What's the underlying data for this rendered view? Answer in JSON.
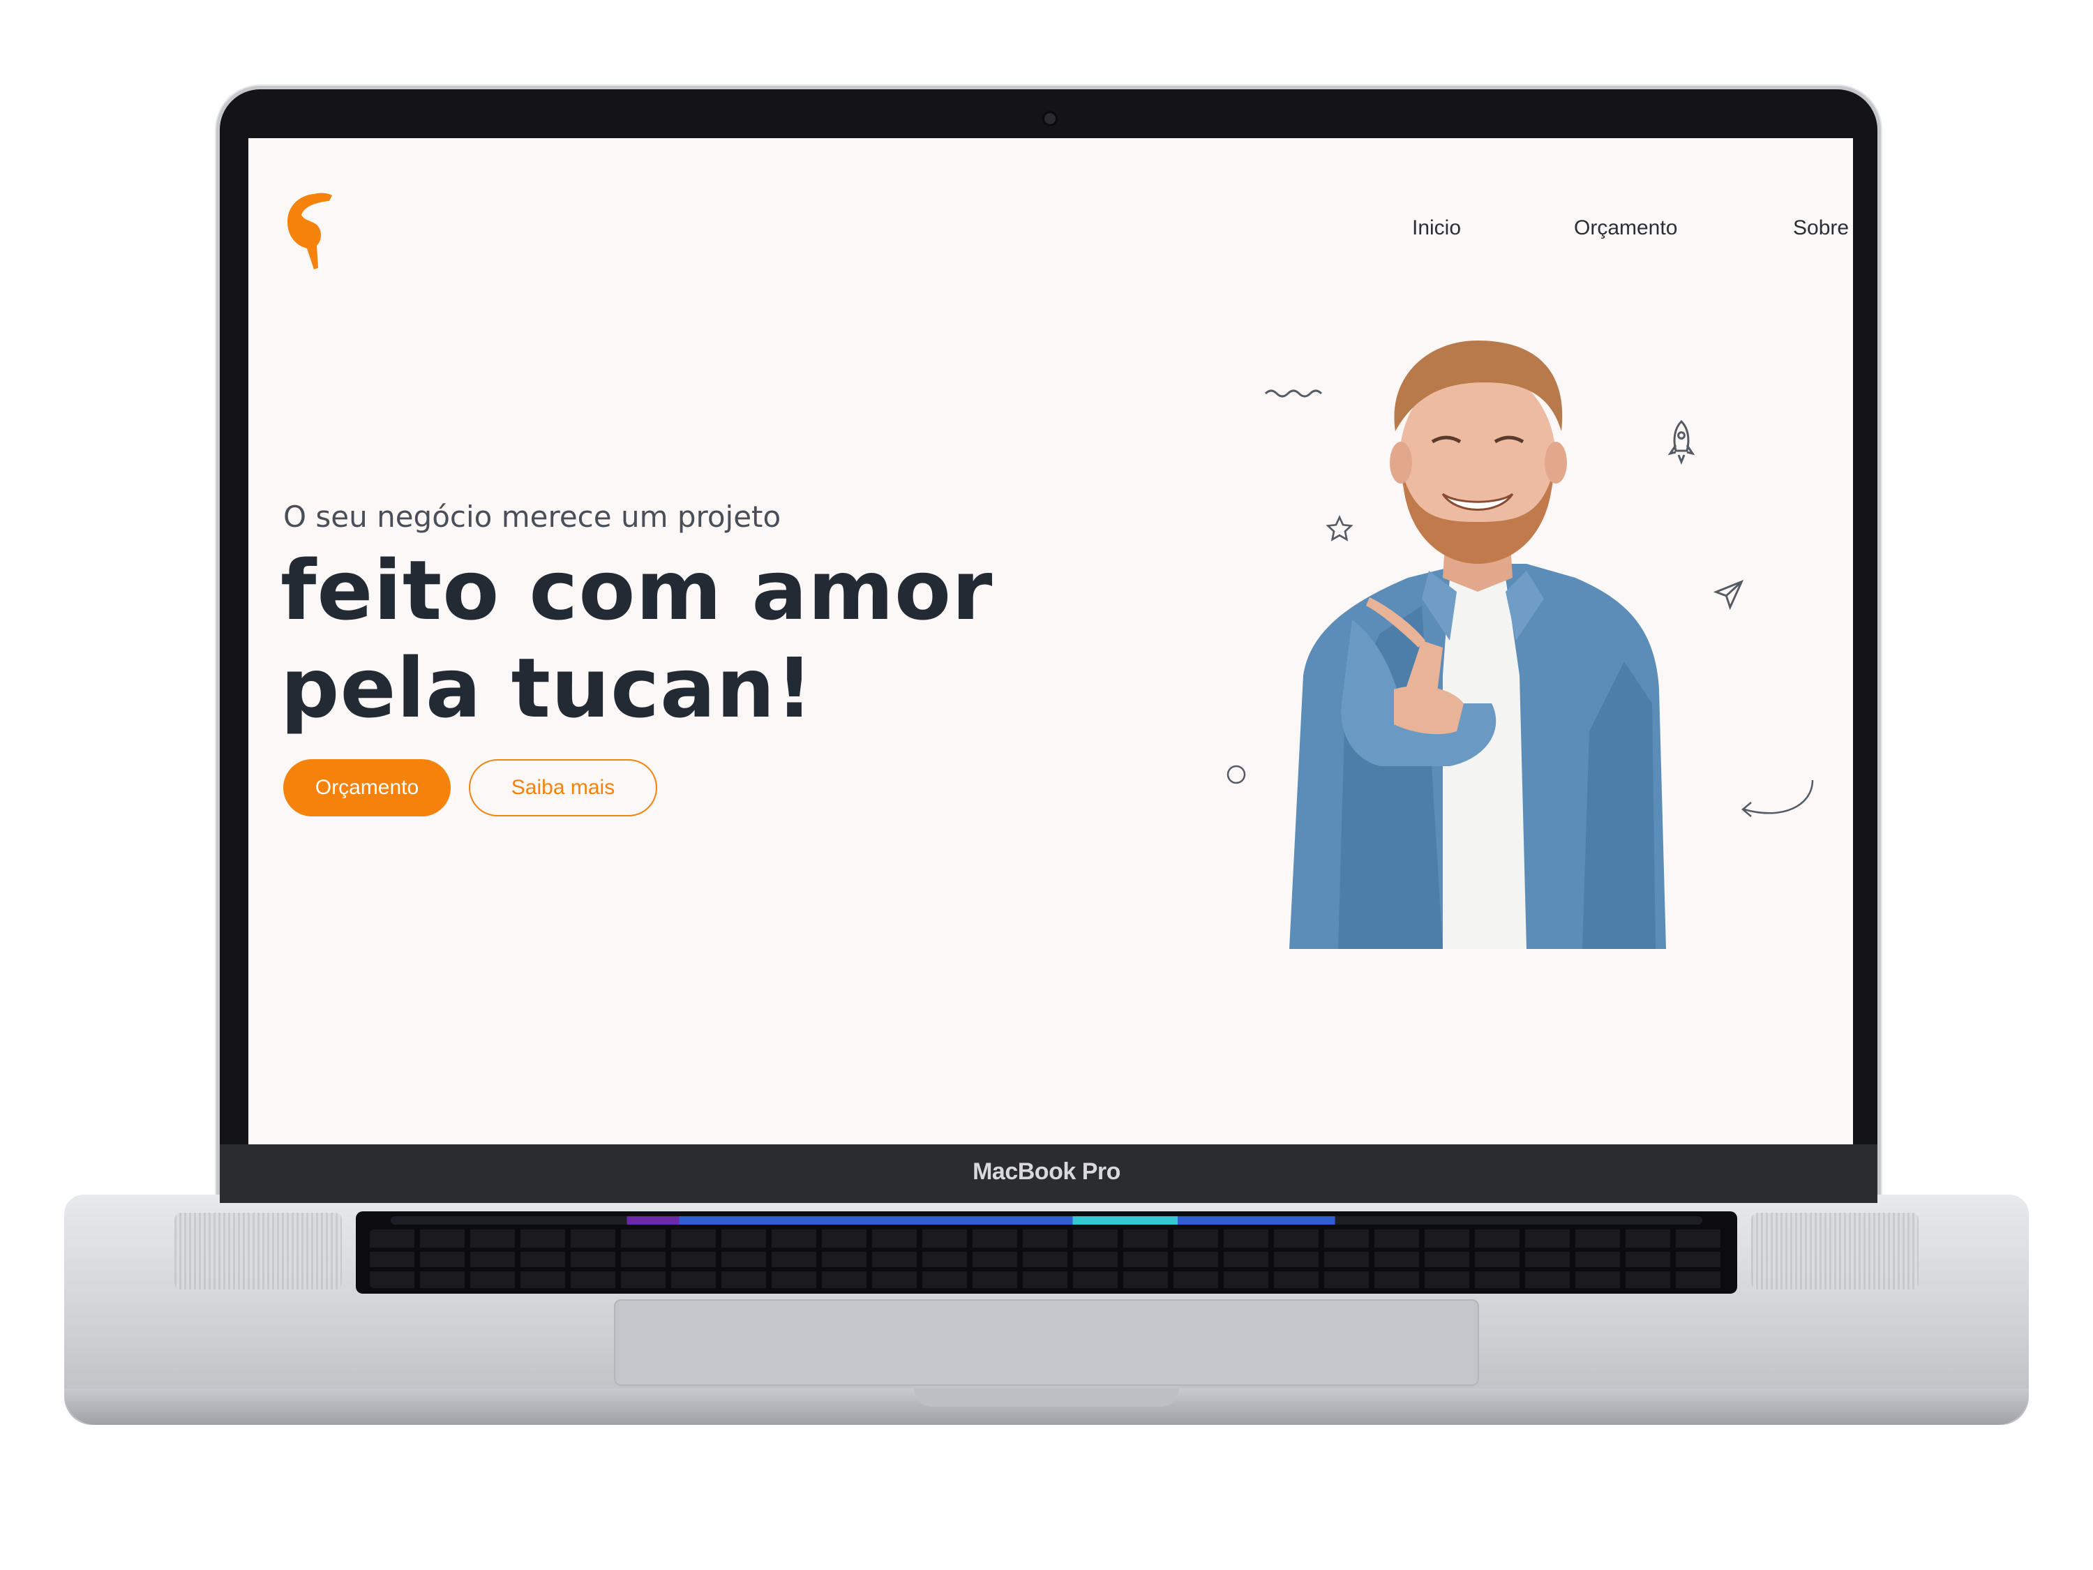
{
  "device": {
    "brand_label": "MacBook Pro"
  },
  "colors": {
    "accent": "#f5820a",
    "text_dark": "#222b33",
    "background": "#fcf8f7"
  },
  "header": {
    "logo_icon": "toucan-logo-icon",
    "nav": [
      {
        "label": "Inicio"
      },
      {
        "label": "Orçamento"
      },
      {
        "label": "Sobre"
      }
    ]
  },
  "hero": {
    "subtitle": "O seu negócio merece um projeto",
    "headline": "feito com amor pela tucan!",
    "primary_button": "Orçamento",
    "secondary_button": "Saiba mais",
    "decorations": [
      "squiggle-icon",
      "star-icon",
      "rocket-icon",
      "paper-plane-icon",
      "circle-icon",
      "curved-arrow-icon"
    ],
    "image": "smiling-man-pointing-photo"
  }
}
